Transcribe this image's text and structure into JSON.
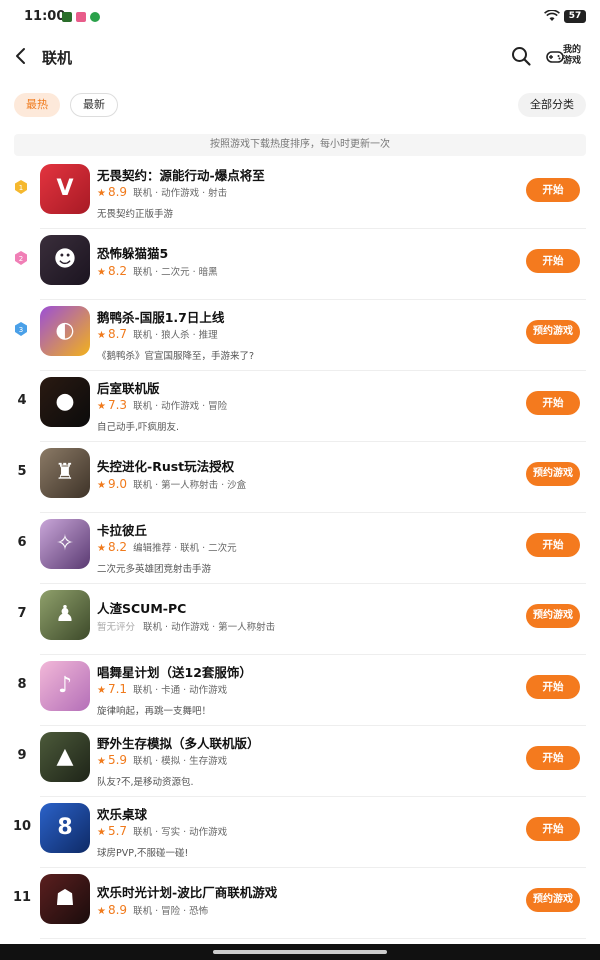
{
  "status": {
    "time": "11:00",
    "battery": "57"
  },
  "header": {
    "title": "联机",
    "my_games_label": "我的游戏"
  },
  "filters": {
    "hot": "最热",
    "new": "最新",
    "all_categories": "全部分类"
  },
  "note": "按照游戏下载热度排序，每小时更新一次",
  "games": [
    {
      "rank": "1",
      "name": "无畏契约：源能行动-爆点将至",
      "score": "8.9",
      "tags": "联机 · 动作游戏 · 射击",
      "desc": "无畏契约正版手游",
      "button": "开始",
      "icon_colors": [
        "#e3343f",
        "#a81a25"
      ],
      "icon_glyph": "V"
    },
    {
      "rank": "2",
      "name": "恐怖躲猫猫5",
      "score": "8.2",
      "tags": "联机 · 二次元 · 暗黑",
      "desc": "",
      "button": "开始",
      "icon_colors": [
        "#3a2e3b",
        "#1b1420"
      ],
      "icon_glyph": "☻"
    },
    {
      "rank": "3",
      "name": "鹅鸭杀-国服1.7日上线",
      "score": "8.7",
      "tags": "联机 · 狼人杀 · 推理",
      "desc": "《鹅鸭杀》官宣国服降至，手游来了?",
      "button": "预约游戏",
      "icon_colors": [
        "#9b4fd6",
        "#f2b21c"
      ],
      "icon_glyph": "◐"
    },
    {
      "rank": "4",
      "name": "后室联机版",
      "score": "7.3",
      "tags": "联机 · 动作游戏 · 冒险",
      "desc": "自己动手,吓疯朋友.",
      "button": "开始",
      "icon_colors": [
        "#2a1a12",
        "#0b0b0b"
      ],
      "icon_glyph": "●"
    },
    {
      "rank": "5",
      "name": "失控进化-Rust玩法授权",
      "score": "9.0",
      "tags": "联机 · 第一人称射击 · 沙盒",
      "desc": "",
      "button": "预约游戏",
      "icon_colors": [
        "#8b7a66",
        "#3e3328"
      ],
      "icon_glyph": "♜"
    },
    {
      "rank": "6",
      "name": "卡拉彼丘",
      "score": "8.2",
      "tags": "编辑推荐 · 联机 · 二次元",
      "desc": "二次元多英雄团竞射击手游",
      "button": "开始",
      "icon_colors": [
        "#c9a6d8",
        "#5a3a72"
      ],
      "icon_glyph": "✧"
    },
    {
      "rank": "7",
      "name": "人渣SCUM-PC",
      "score": "暂无评分",
      "tags": "联机 · 动作游戏 · 第一人称射击",
      "desc": "",
      "button": "预约游戏",
      "icon_colors": [
        "#8fa06b",
        "#3d4a2a"
      ],
      "icon_glyph": "♟"
    },
    {
      "rank": "8",
      "name": "唱舞星计划（送12套服饰）",
      "score": "7.1",
      "tags": "联机 · 卡通 · 动作游戏",
      "desc": "旋律响起，再跳一支舞吧！",
      "button": "开始",
      "icon_colors": [
        "#f2b8d8",
        "#b46fb8"
      ],
      "icon_glyph": "♪"
    },
    {
      "rank": "9",
      "name": "野外生存模拟（多人联机版）",
      "score": "5.9",
      "tags": "联机 · 模拟 · 生存游戏",
      "desc": "队友?不,是移动资源包.",
      "button": "开始",
      "icon_colors": [
        "#4c5a3a",
        "#1e2418"
      ],
      "icon_glyph": "▲"
    },
    {
      "rank": "10",
      "name": "欢乐桌球",
      "score": "5.7",
      "tags": "联机 · 写实 · 动作游戏",
      "desc": "球房PVP,不服碰一碰!",
      "button": "开始",
      "icon_colors": [
        "#2b62c9",
        "#0e2a66"
      ],
      "icon_glyph": "8"
    },
    {
      "rank": "11",
      "name": "欢乐时光计划-波比厂商联机游戏",
      "score": "8.9",
      "tags": "联机 · 冒险 · 恐怖",
      "desc": "",
      "button": "预约游戏",
      "icon_colors": [
        "#5b1f1f",
        "#1a0c0c"
      ],
      "icon_glyph": "☗"
    }
  ],
  "colors": {
    "accent": "#f47a1e",
    "gold": "#f5b82e",
    "pink": "#f07fb6",
    "blue": "#4aa0e8"
  }
}
